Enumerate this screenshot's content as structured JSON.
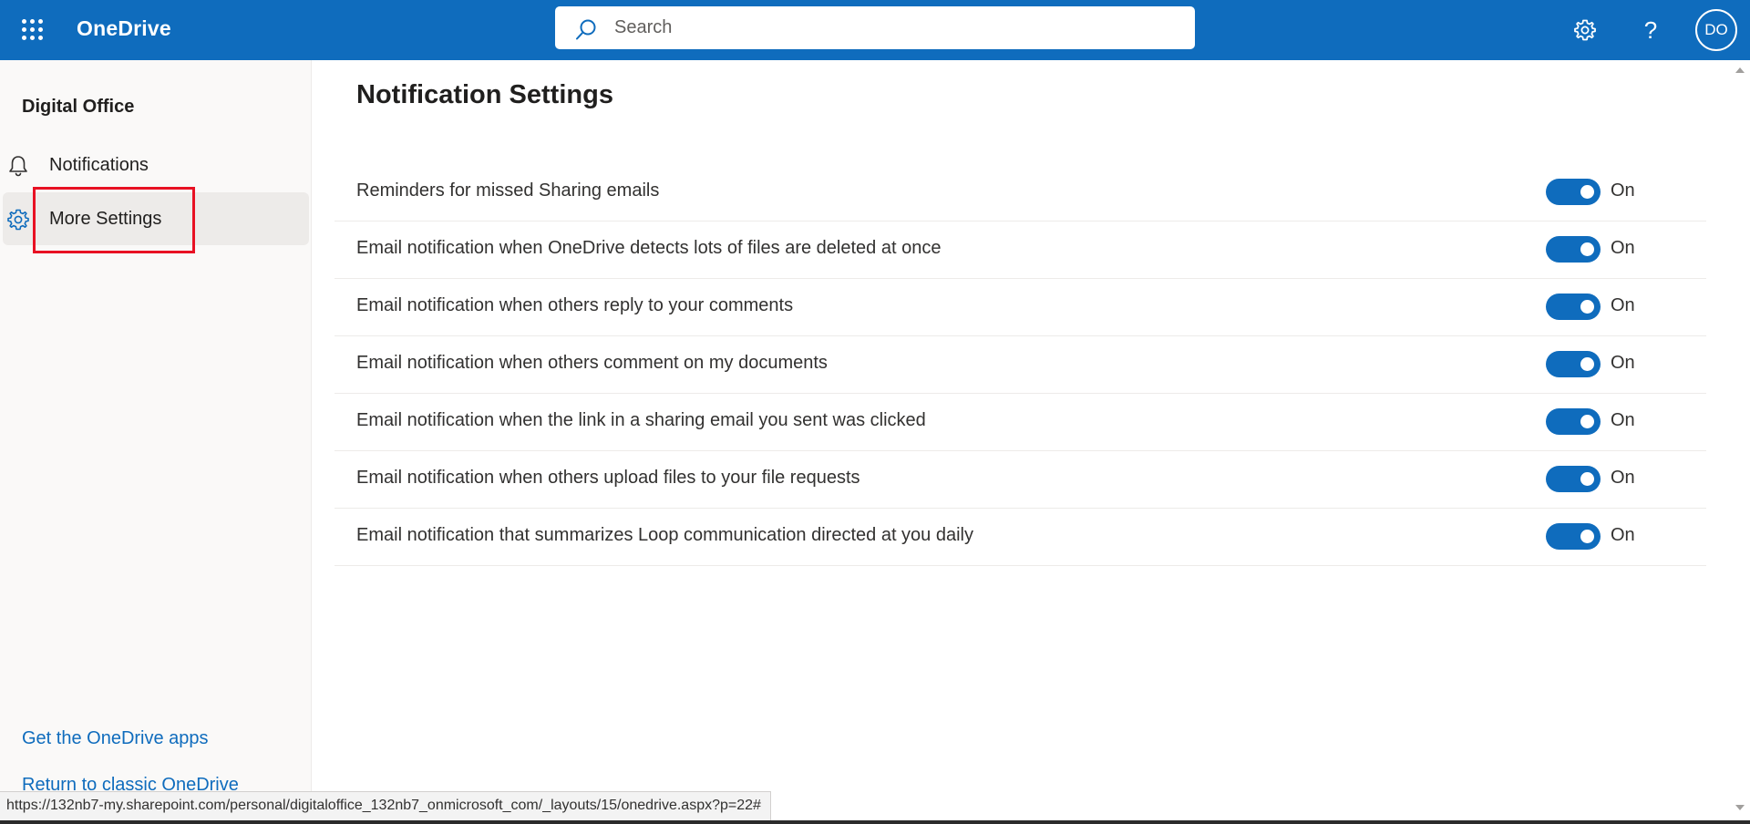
{
  "header": {
    "app_name": "OneDrive",
    "search": {
      "placeholder": "Search",
      "value": ""
    },
    "settings_icon": "gear-icon",
    "help_icon": "question-icon",
    "help_glyph": "?",
    "avatar_initials": "DO",
    "brand_color": "#0f6cbd"
  },
  "sidebar": {
    "org_name": "Digital Office",
    "items": [
      {
        "label": "Notifications",
        "icon": "bell-icon",
        "active": false
      },
      {
        "label": "More Settings",
        "icon": "gear-icon",
        "active": true
      }
    ],
    "links": [
      {
        "label": "Get the OneDrive apps"
      },
      {
        "label": "Return to classic OneDrive"
      }
    ]
  },
  "main": {
    "title": "Notification Settings",
    "settings": [
      {
        "label": "Reminders for missed Sharing emails",
        "state": "On"
      },
      {
        "label": "Email notification when OneDrive detects lots of files are deleted at once",
        "state": "On"
      },
      {
        "label": "Email notification when others reply to your comments",
        "state": "On"
      },
      {
        "label": "Email notification when others comment on my documents",
        "state": "On"
      },
      {
        "label": "Email notification when the link in a sharing email you sent was clicked",
        "state": "On"
      },
      {
        "label": "Email notification when others upload files to your file requests",
        "state": "On"
      },
      {
        "label": "Email notification that summarizes Loop communication directed at you daily",
        "state": "On"
      }
    ]
  },
  "status_bar": {
    "url": "https://132nb7-my.sharepoint.com/personal/digitaloffice_132nb7_onmicrosoft_com/_layouts/15/onedrive.aspx?p=22#"
  },
  "colors": {
    "accent": "#0f6cbd",
    "highlight_box": "#e81123"
  }
}
